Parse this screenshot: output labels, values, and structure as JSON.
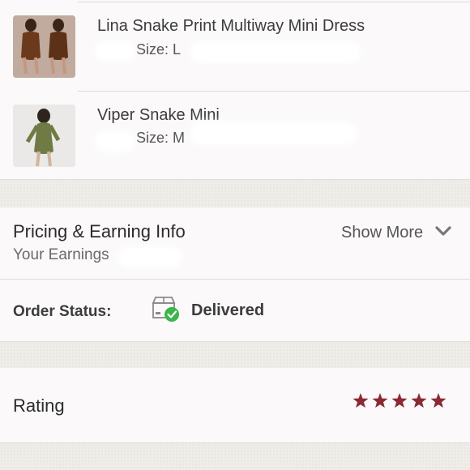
{
  "items": [
    {
      "name": "Lina Snake Print Multiway Mini Dress",
      "size_text": "Size: L"
    },
    {
      "name": "Viper Snake Mini",
      "size_text": "Size: M"
    }
  ],
  "pricing": {
    "title": "Pricing & Earning Info",
    "earnings_label": "Your Earnings",
    "show_more_label": "Show More"
  },
  "order_status": {
    "label": "Order Status:",
    "value": "Delivered",
    "status_color": "#3cb54a"
  },
  "rating": {
    "title": "Rating",
    "stars": 5,
    "max_stars": 5,
    "star_color": "#8b2a35"
  },
  "icons": [
    "box-check-icon",
    "chevron-down-icon",
    "star-icon"
  ]
}
